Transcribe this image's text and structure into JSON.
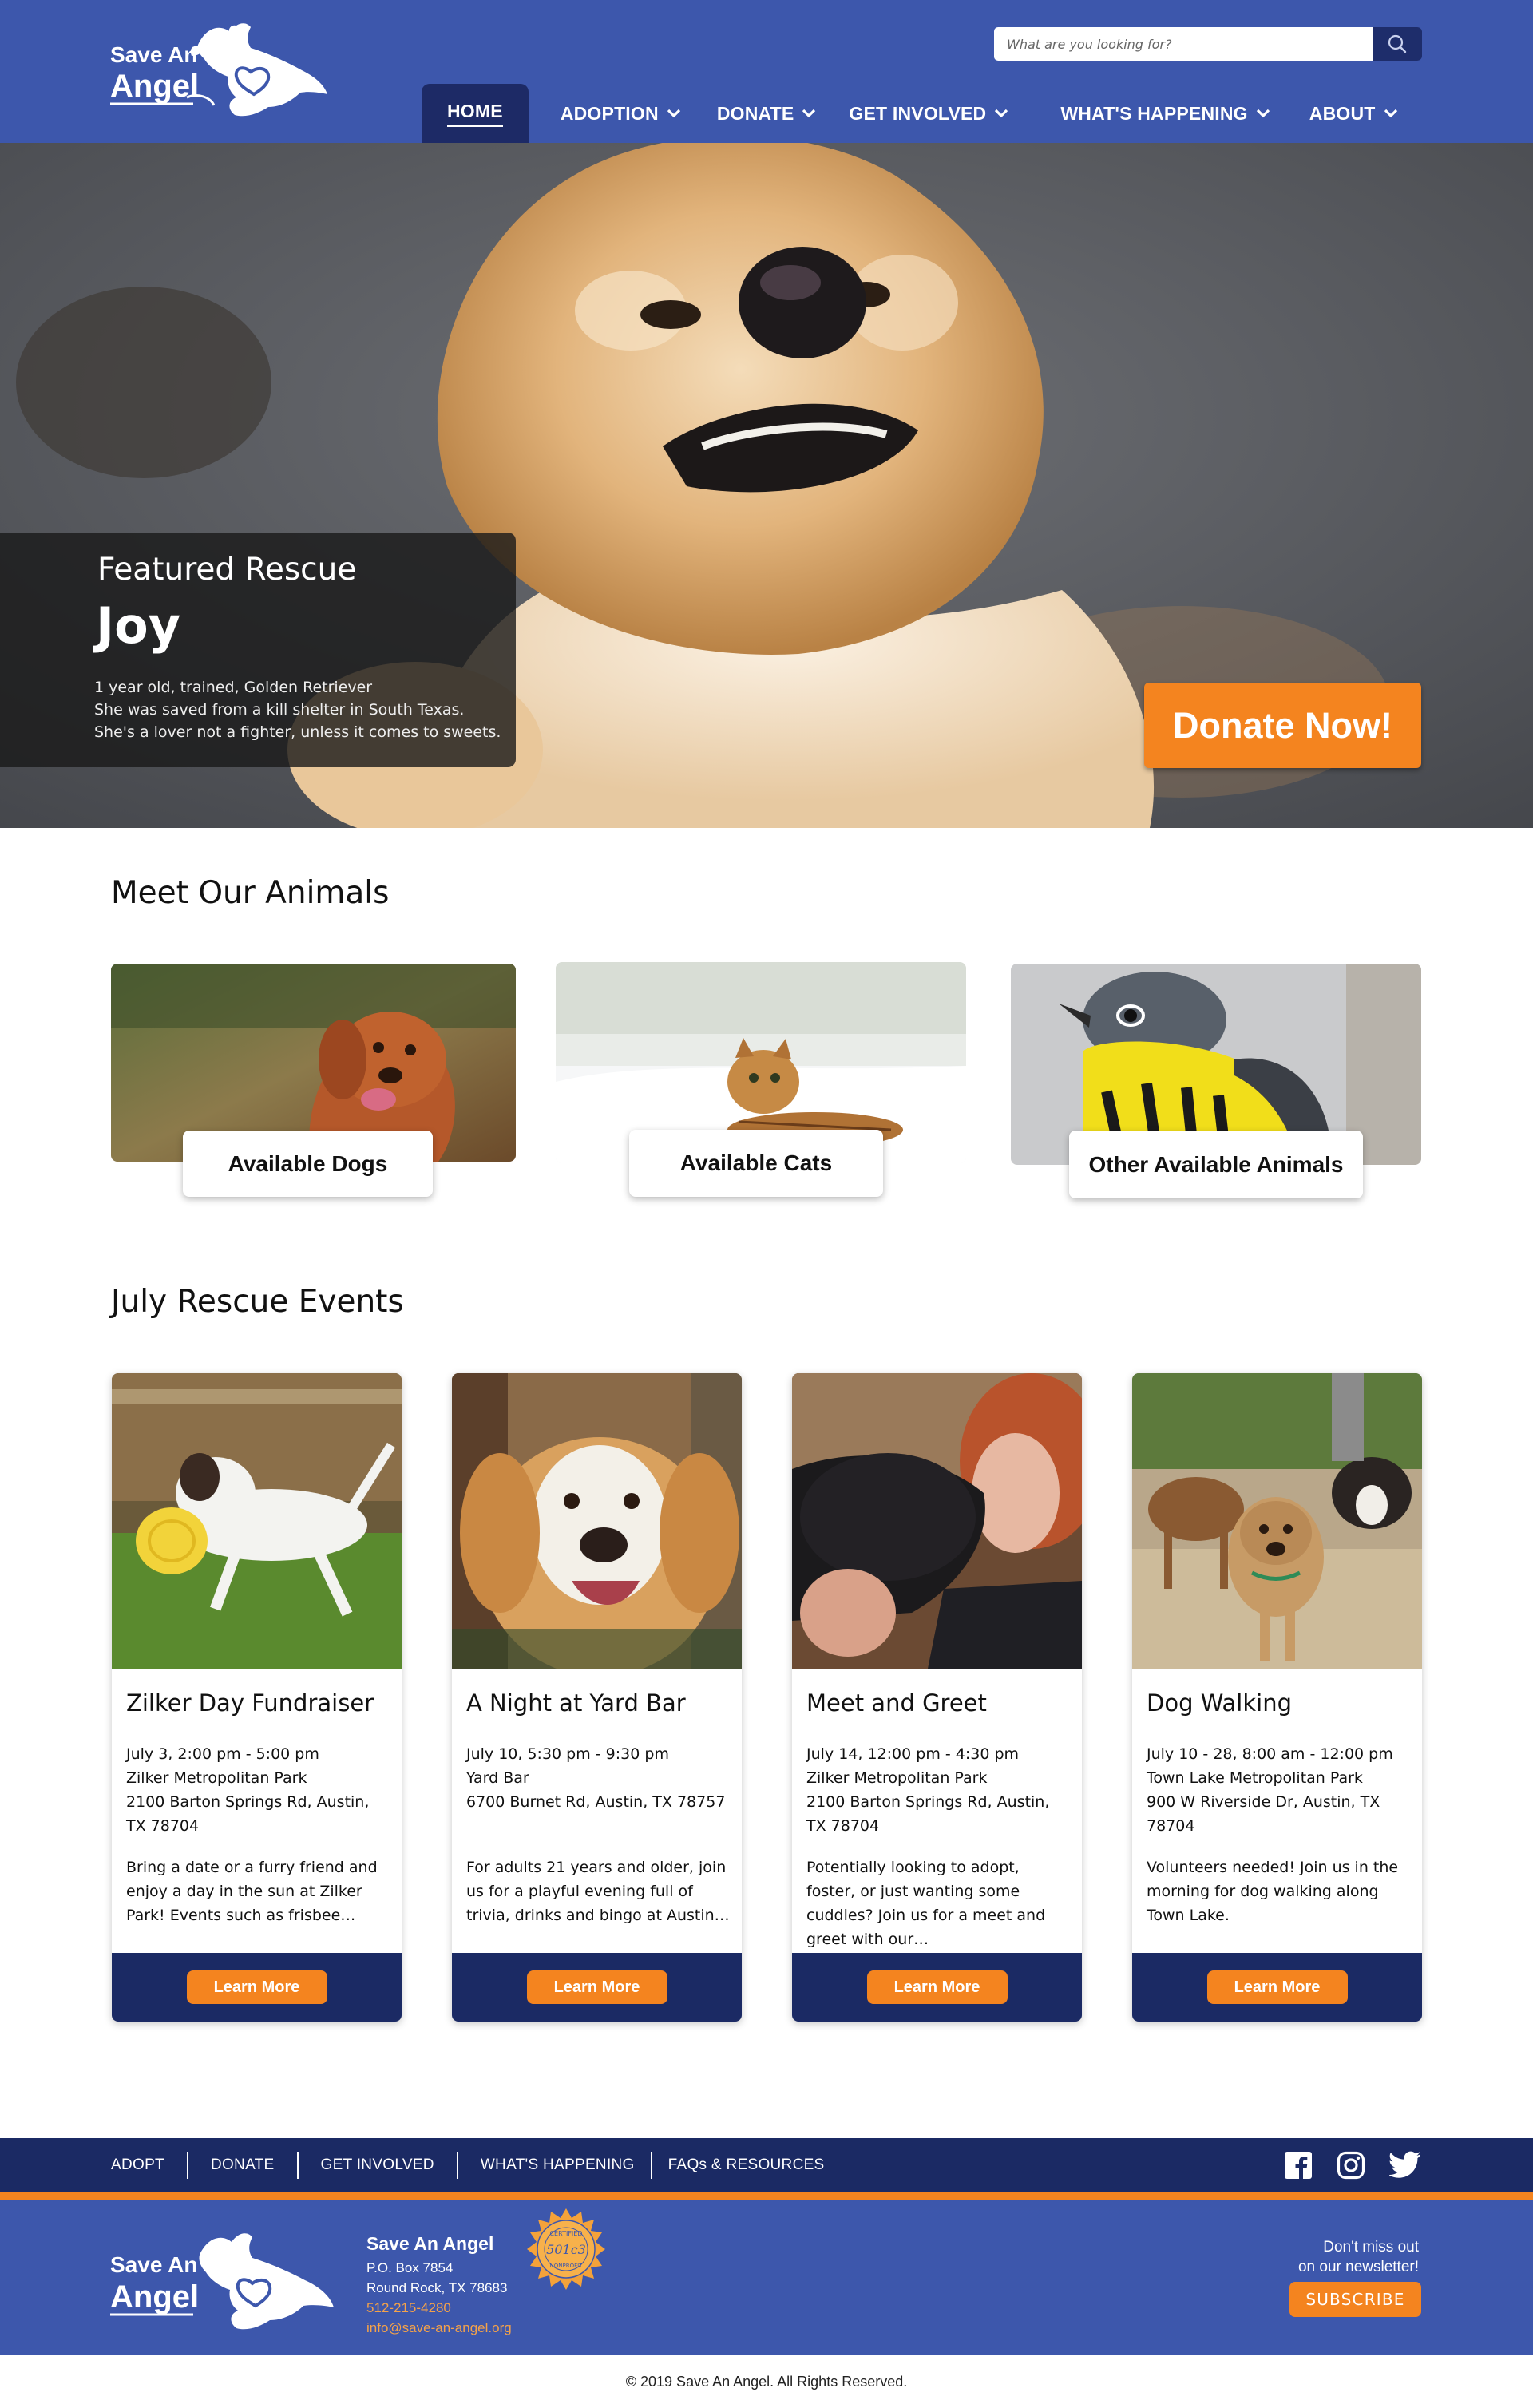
{
  "brand": {
    "logo_line1": "Save An",
    "logo_line2": "Angel",
    "colors": {
      "primary": "#3d57ac",
      "navy": "#1b2a64",
      "accent": "#f4841f"
    }
  },
  "search": {
    "placeholder": "What are you looking for?",
    "icon": "search-icon"
  },
  "nav": {
    "items": [
      {
        "label": "HOME",
        "active": true
      },
      {
        "label": "ADOPTION",
        "dropdown": true
      },
      {
        "label": "DONATE",
        "dropdown": true
      },
      {
        "label": "GET INVOLVED",
        "dropdown": true
      },
      {
        "label": "WHAT'S HAPPENING",
        "dropdown": true
      },
      {
        "label": "ABOUT",
        "dropdown": true
      }
    ]
  },
  "hero": {
    "kicker": "Featured Rescue",
    "name": "Joy",
    "description": [
      "1 year old, trained, Golden Retriever",
      "She was saved from a kill shelter in South Texas.",
      "She's a lover not a fighter, unless it comes to sweets."
    ],
    "donate_label": "Donate Now!"
  },
  "animals": {
    "title": "Meet Our Animals",
    "cards": [
      {
        "label": "Available Dogs"
      },
      {
        "label": "Available Cats"
      },
      {
        "label": "Other Available Animals"
      }
    ]
  },
  "events": {
    "title": "July Rescue Events",
    "cards": [
      {
        "title": "Zilker Day Fundraiser",
        "info": [
          "July 3, 2:00 pm - 5:00 pm",
          "Zilker Metropolitan Park",
          "2100 Barton Springs Rd, Austin, TX 78704"
        ],
        "description": "Bring a date or a furry friend and enjoy a day in the sun at Zilker Park!  Events such as frisbee…",
        "button": "Learn More"
      },
      {
        "title": "A Night at Yard Bar",
        "info": [
          "July 10, 5:30 pm - 9:30 pm",
          "Yard Bar",
          "6700 Burnet Rd, Austin, TX 78757"
        ],
        "description": "For adults 21 years and older, join us for a playful evening full of trivia, drinks and bingo at Austin…",
        "button": "Learn More"
      },
      {
        "title": "Meet and Greet",
        "info": [
          "July 14, 12:00 pm - 4:30 pm",
          "Zilker Metropolitan Park",
          "2100 Barton Springs Rd, Austin, TX 78704"
        ],
        "description": "Potentially looking to adopt, foster, or just wanting some cuddles? Join us for a meet and greet with our…",
        "button": "Learn More"
      },
      {
        "title": "Dog Walking",
        "info": [
          "July 10 - 28, 8:00 am -  12:00 pm",
          "Town Lake Metropolitan Park",
          "900 W Riverside Dr, Austin, TX 78704"
        ],
        "description": "Volunteers needed! Join us in the morning for dog walking along Town Lake.",
        "button": "Learn More"
      }
    ]
  },
  "footer": {
    "links": [
      "ADOPT",
      "DONATE",
      "GET INVOLVED",
      "WHAT'S HAPPENING",
      "FAQs & RESOURCES"
    ],
    "social_icons": [
      "facebook-icon",
      "instagram-icon",
      "twitter-icon"
    ],
    "org_name": "Save An Angel",
    "address_line1": "P.O. Box 7854",
    "address_line2": "Round Rock, TX 78683",
    "phone": "512-215-4280",
    "email": "info@save-an-angel.org",
    "seal_top": "CERTIFIED",
    "seal_middle": "501c3",
    "seal_bottom": "NONPROFIT",
    "newsletter_line1": "Don't miss out",
    "newsletter_line2": "on our newsletter!",
    "subscribe_label": "SUBSCRIBE",
    "copyright": "© 2019 Save An Angel. All Rights Reserved."
  }
}
